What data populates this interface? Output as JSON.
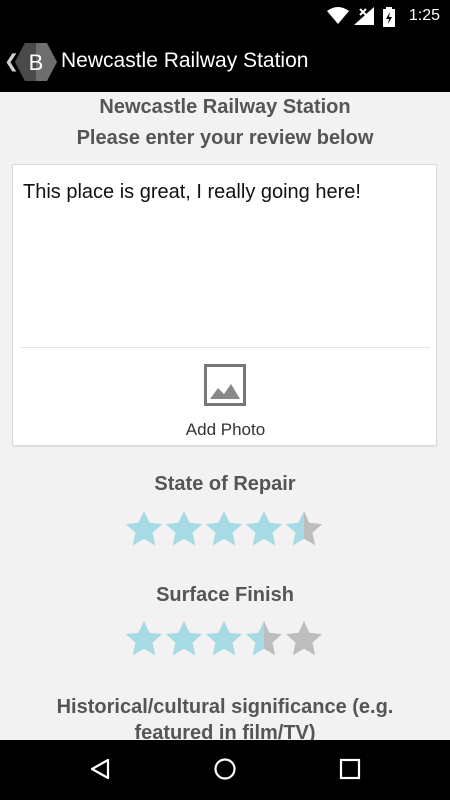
{
  "status_bar": {
    "time": "1:25",
    "icons": [
      "wifi-icon",
      "signal-icon",
      "battery-icon"
    ]
  },
  "app_bar": {
    "back_icon": "back-chevron-icon",
    "logo_letter": "B",
    "title": "Newcastle Railway Station"
  },
  "page": {
    "heading": "Newcastle Railway Station",
    "subheading": "Please enter your review below"
  },
  "review": {
    "text": "This place is great, I really going here!",
    "add_photo_label": "Add Photo"
  },
  "ratings": [
    {
      "label": "State of Repair",
      "value": 4.5,
      "max": 5
    },
    {
      "label": "Surface Finish",
      "value": 3.5,
      "max": 5
    }
  ],
  "partial_rating": {
    "label": "Historical/cultural significance (e.g. featured in film/TV)"
  },
  "colors": {
    "star_filled": "#a6dbe6",
    "star_empty": "#bdbdbd",
    "heading_text": "#555555",
    "background": "#f2f2f2"
  },
  "nav_bar": {
    "icons": [
      "back-triangle-icon",
      "home-circle-icon",
      "recents-square-icon"
    ]
  }
}
